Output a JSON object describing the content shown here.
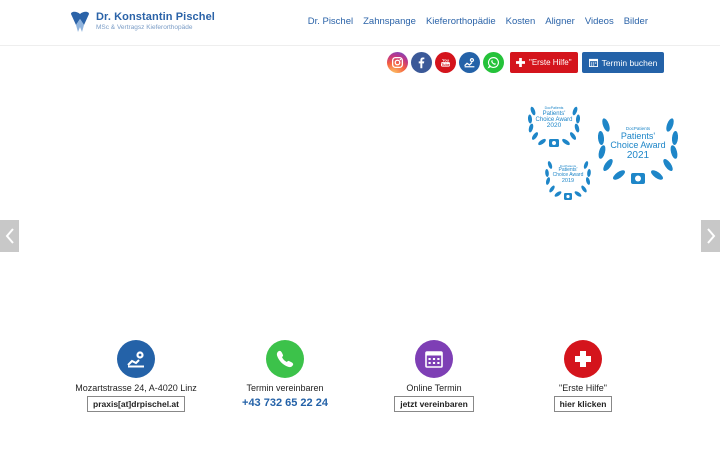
{
  "header": {
    "logo_name": "Dr. Konstantin Pischel",
    "logo_sub": "MSc & Vertragsz Kieferorthopäde",
    "nav": [
      "Dr. Pischel",
      "Zahnspange",
      "Kieferorthopädie",
      "Kosten",
      "Aligner",
      "Videos",
      "Bilder"
    ]
  },
  "actions": {
    "social_icons": [
      "instagram-icon",
      "facebook-icon",
      "youtube-icon",
      "location-icon",
      "whatsapp-icon"
    ],
    "first_aid_label": "\"Erste Hilfe\"",
    "booking_label": "Termin buchen"
  },
  "awards": [
    {
      "small": "DocPatients",
      "line1": "Patients'",
      "line2": "Choice Award",
      "year": "2020"
    },
    {
      "small": "DocPatients",
      "line1": "Patients'",
      "line2": "Choice Award",
      "year": "2021"
    },
    {
      "small": "DocPatients",
      "line1": "Patients'",
      "line2": "Choice Award",
      "year": "2019"
    }
  ],
  "info": {
    "address": {
      "label": "Mozartstrasse 24, A-4020 Linz",
      "button": "praxis[at]drpischel.at",
      "icon": "location-icon",
      "color": "#2462a8"
    },
    "phone": {
      "label": "Termin vereinbaren",
      "number": "+43 732 65 22 24",
      "icon": "phone-icon",
      "color": "#3cc24a"
    },
    "online": {
      "label": "Online Termin",
      "button": "jetzt vereinbaren",
      "icon": "calendar-icon",
      "color": "#7e3fb5"
    },
    "first_aid": {
      "label": "\"Erste Hilfe\"",
      "button": "hier klicken",
      "icon": "cross-icon",
      "color": "#d4141c"
    }
  },
  "colors": {
    "brand_blue": "#2462a8",
    "award_blue": "#1e86c8",
    "red": "#d4141c"
  }
}
